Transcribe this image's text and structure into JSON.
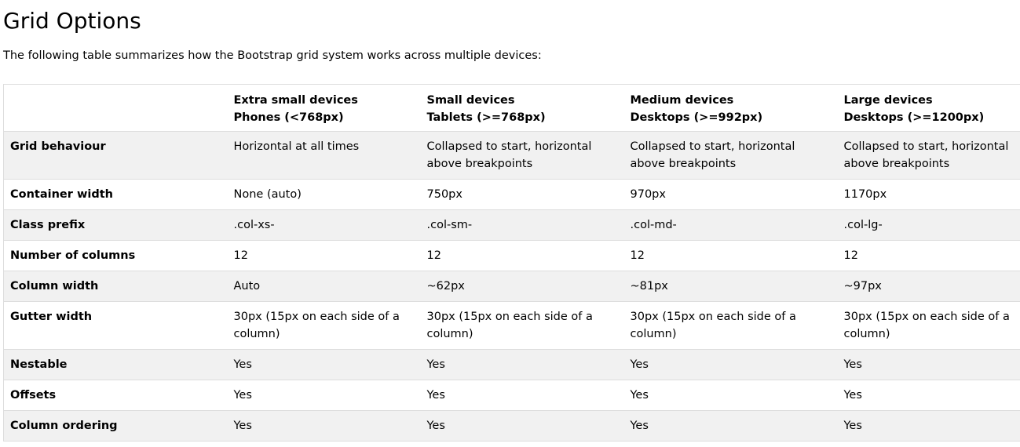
{
  "page": {
    "title": "Grid Options",
    "intro": "The following table summarizes how the Bootstrap grid system works across multiple devices:"
  },
  "table": {
    "header": [
      {
        "line1": "",
        "line2": ""
      },
      {
        "line1": "Extra small devices",
        "line2": "Phones (<768px)"
      },
      {
        "line1": "Small devices",
        "line2": "Tablets (>=768px)"
      },
      {
        "line1": "Medium devices",
        "line2": "Desktops (>=992px)"
      },
      {
        "line1": "Large devices",
        "line2": "Desktops (>=1200px)"
      }
    ],
    "rows": [
      {
        "label": "Grid behaviour",
        "cells": [
          "Horizontal at all times",
          "Collapsed to start, horizontal above breakpoints",
          "Collapsed to start, horizontal above breakpoints",
          "Collapsed to start, horizontal above breakpoints"
        ]
      },
      {
        "label": "Container width",
        "cells": [
          "None (auto)",
          "750px",
          "970px",
          "1170px"
        ]
      },
      {
        "label": "Class prefix",
        "cells": [
          ".col-xs-",
          ".col-sm-",
          ".col-md-",
          ".col-lg-"
        ]
      },
      {
        "label": "Number of columns",
        "cells": [
          "12",
          "12",
          "12",
          "12"
        ]
      },
      {
        "label": "Column width",
        "cells": [
          "Auto",
          "~62px",
          "~81px",
          "~97px"
        ]
      },
      {
        "label": "Gutter width",
        "cells": [
          "30px (15px on each side of a column)",
          "30px (15px on each side of a column)",
          "30px (15px on each side of a column)",
          "30px (15px on each side of a column)"
        ]
      },
      {
        "label": "Nestable",
        "cells": [
          "Yes",
          "Yes",
          "Yes",
          "Yes"
        ]
      },
      {
        "label": "Offsets",
        "cells": [
          "Yes",
          "Yes",
          "Yes",
          "Yes"
        ]
      },
      {
        "label": "Column ordering",
        "cells": [
          "Yes",
          "Yes",
          "Yes",
          "Yes"
        ]
      }
    ]
  },
  "colors": {
    "text": "#000000",
    "border": "#dddddd",
    "stripe": "#f1f1f1",
    "background": "#ffffff"
  }
}
